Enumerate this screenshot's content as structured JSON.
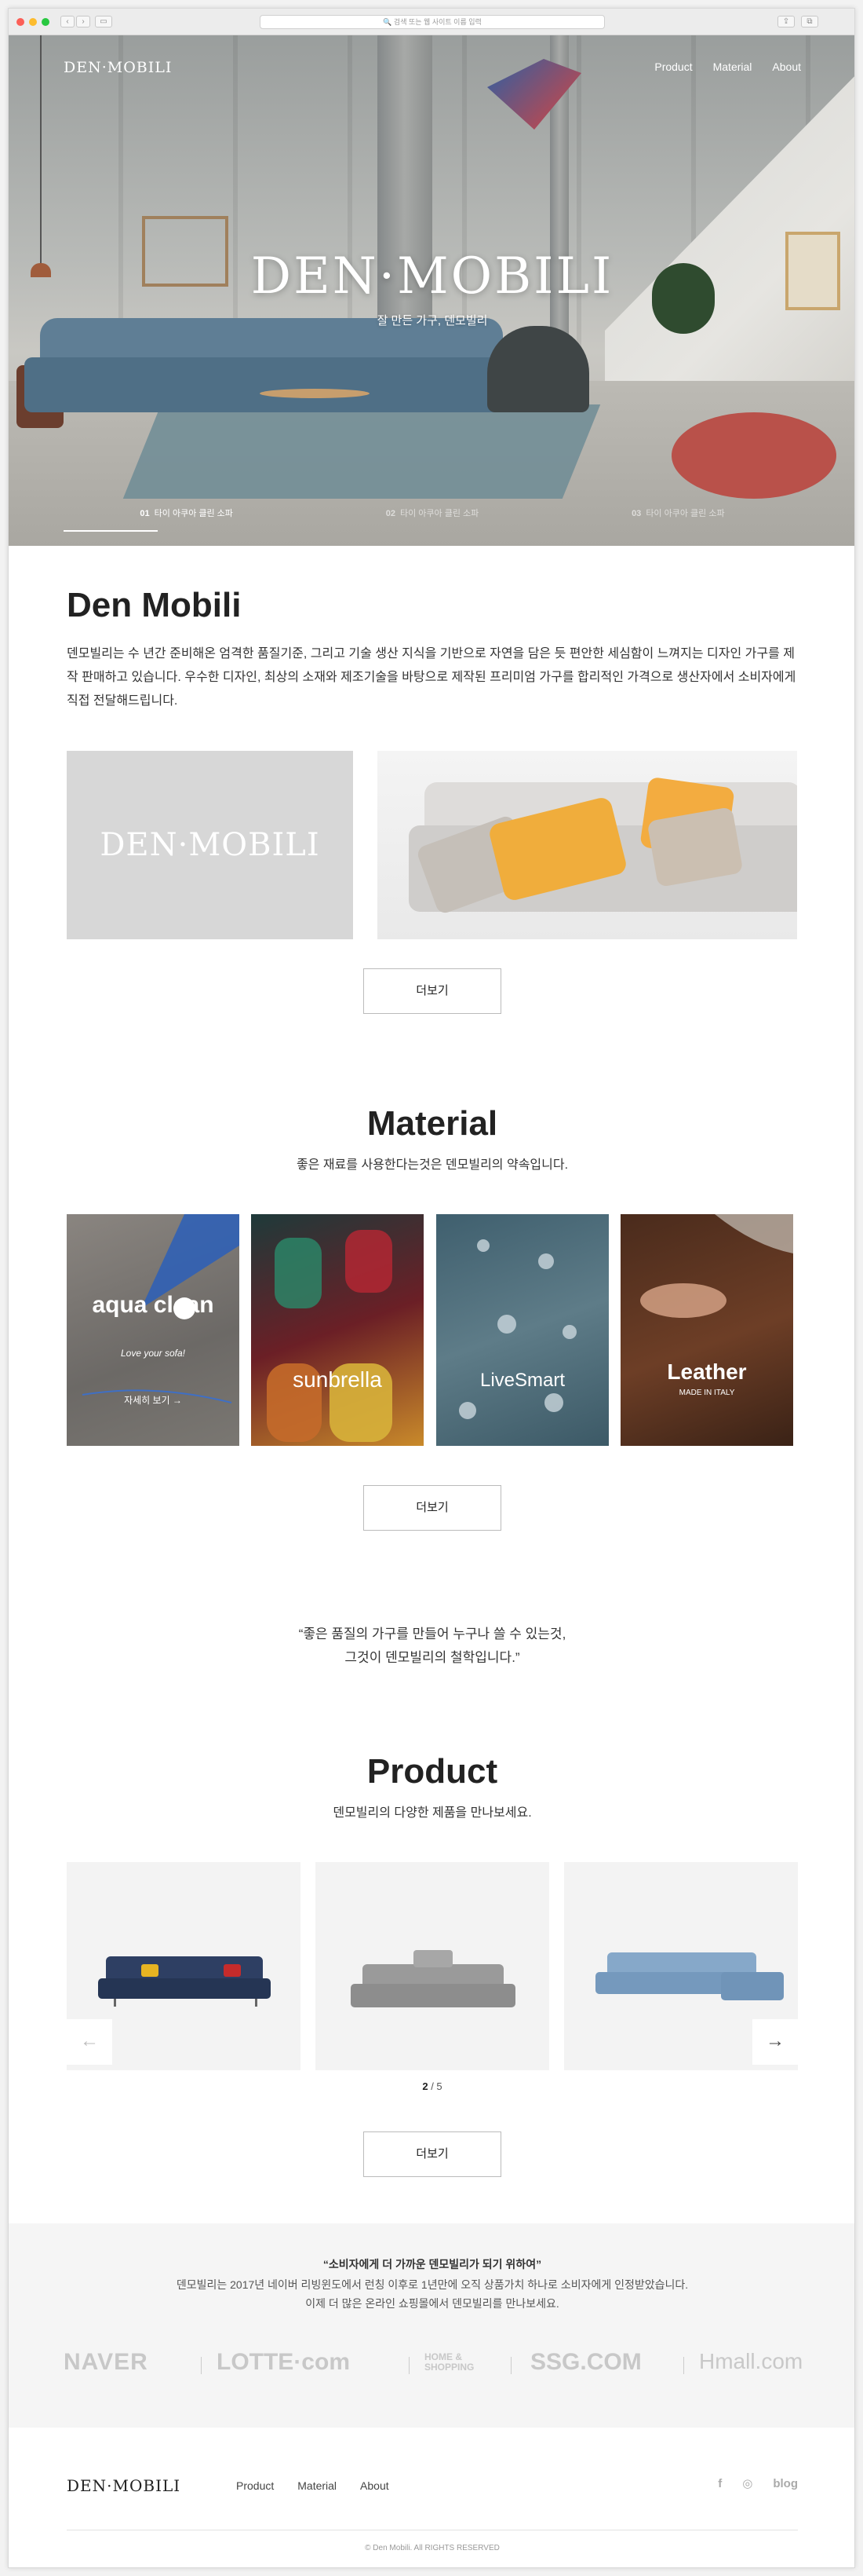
{
  "browser": {
    "address_bar": "검색 또는 웹 사이트 이름 입력"
  },
  "hero": {
    "logo": "DEN·MOBILI",
    "nav": [
      "Product",
      "Material",
      "About"
    ],
    "title": "DEN·MOBILI",
    "subtitle": "잘 만든 가구, 덴모빌리",
    "tabs": [
      {
        "num": "01",
        "label": "타이 아쿠아 클린 소파"
      },
      {
        "num": "02",
        "label": "타이 아쿠아 클린 소파"
      },
      {
        "num": "03",
        "label": "타이 아쿠아 클린 소파"
      }
    ],
    "active_tab": 0
  },
  "about": {
    "title": "Den Mobili",
    "text": "덴모빌리는 수 년간 준비해온 엄격한 품질기준, 그리고 기술 생산 지식을 기반으로 자연을 담은 듯 편안한 세심함이 느껴지는 디자인 가구를 제작 판매하고 있습니다. 우수한 디자인, 최상의 소재와 제조기술을 바탕으로 제작된 프리미엄 가구를 합리적인 가격으로 생산자에서 소비자에게 직접 전달해드립니다.",
    "logo_box": "DEN·MOBILI",
    "more": "더보기"
  },
  "material": {
    "title": "Material",
    "subtitle": "좋은 재료를 사용한다는것은 덴모빌리의 약속입니다.",
    "items": [
      {
        "name": "aqua clean",
        "tagline": "Love your sofa!",
        "link": "자세히 보기 →"
      },
      {
        "name": "sunbrella",
        "tagline": ""
      },
      {
        "name": "LiveSmart",
        "tagline": ""
      },
      {
        "name": "Leather",
        "tagline": "MADE IN ITALY"
      }
    ],
    "more": "더보기"
  },
  "quote": {
    "line1": "“좋은 품질의 가구를 만들어 누구나 쓸 수 있는것,",
    "line2": "그것이 덴모빌리의 철학입니다.”"
  },
  "product": {
    "title": "Product",
    "subtitle": "덴모빌리의 다양한 제품을 만나보세요.",
    "pager_current": "2",
    "pager_total": "/ 5",
    "prev": "←",
    "next": "→",
    "more": "더보기"
  },
  "partners": {
    "headline": "“소비자에게 더 가까운 덴모빌리가 되기 위하여”",
    "line1": "덴모빌리는 2017년 네이버 리빙윈도에서 런칭 이후로 1년만에 오직 상품가치 하나로 소비자에게 인정받았습니다.",
    "line2": "이제 더 많은 온라인 쇼핑몰에서 덴모빌리를 만나보세요.",
    "logos": [
      "NAVER",
      "LOTTE·com",
      "HOME & SHOPPING",
      "SSG.COM",
      "Hmall.com"
    ]
  },
  "footer": {
    "logo": "DEN·MOBILI",
    "nav": [
      "Product",
      "Material",
      "About"
    ],
    "social": [
      "f",
      "◎",
      "blog"
    ],
    "copyright": "© Den Mobili. All RIGHTS RESERVED"
  }
}
